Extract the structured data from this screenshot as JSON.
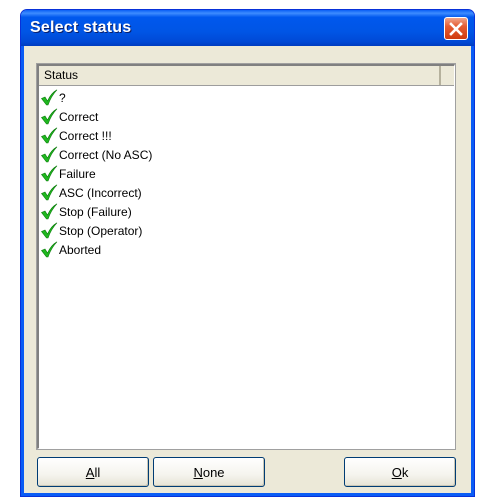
{
  "dialog": {
    "title": "Select status",
    "close_icon": "close-x-icon",
    "title_color": "#0055e5",
    "close_color": "#e55c32"
  },
  "list": {
    "column_header": "Status",
    "row_icon": "green-checkmark-icon",
    "check_color": "#1fb81f",
    "items": [
      {
        "label": "?"
      },
      {
        "label": "Correct"
      },
      {
        "label": "Correct !!!"
      },
      {
        "label": "Correct (No ASC)"
      },
      {
        "label": "Failure"
      },
      {
        "label": "ASC (Incorrect)"
      },
      {
        "label": "Stop (Failure)"
      },
      {
        "label": "Stop (Operator)"
      },
      {
        "label": "Aborted"
      }
    ]
  },
  "buttons": {
    "all": {
      "mnemonic": "A",
      "rest": "ll"
    },
    "none": {
      "mnemonic": "N",
      "rest": "one"
    },
    "ok": {
      "mnemonic": "O",
      "rest": "k"
    }
  }
}
